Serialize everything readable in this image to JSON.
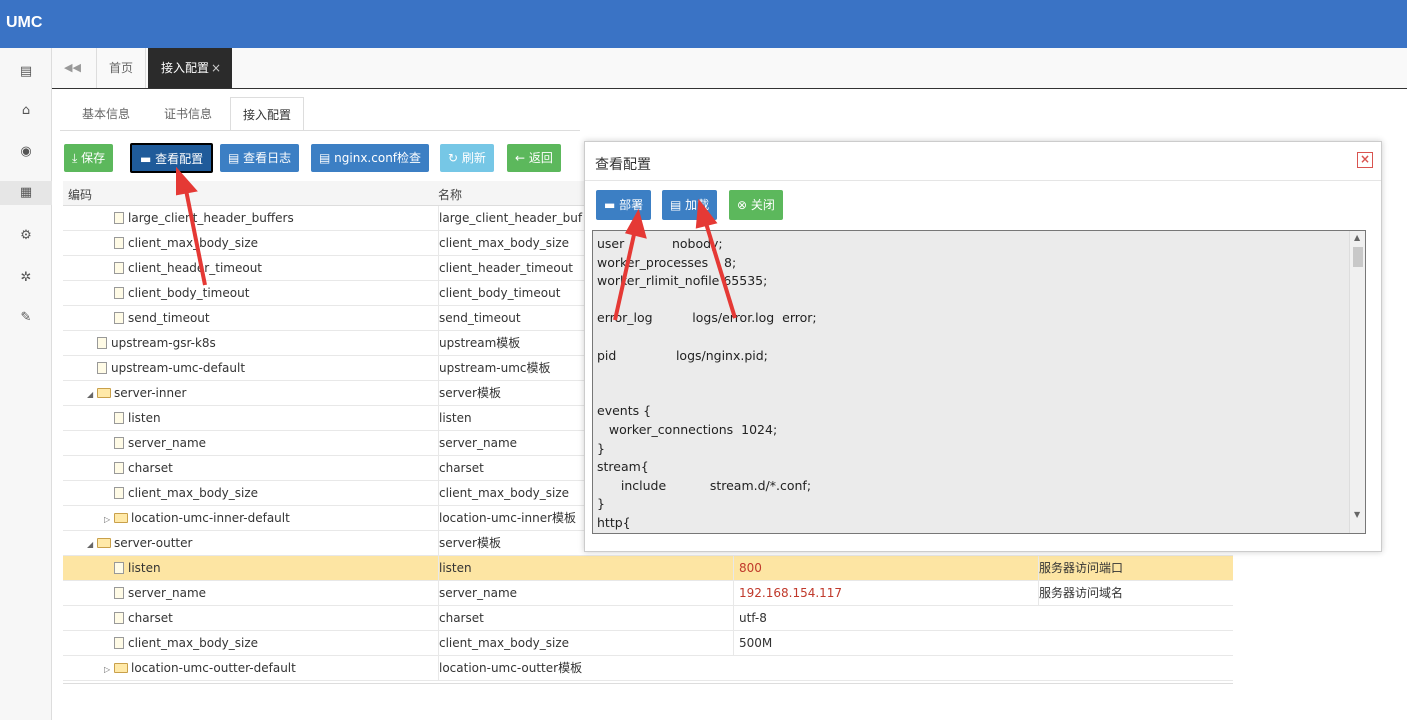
{
  "app": {
    "logo": "UMC"
  },
  "tabs": {
    "home": "首页",
    "active": "接入配置",
    "close": "×"
  },
  "subtabs": [
    "基本信息",
    "证书信息",
    "接入配置"
  ],
  "toolbar": {
    "save": "保存",
    "view_config": "查看配置",
    "view_log": "查看日志",
    "nginx_check": "nginx.conf检查",
    "refresh": "刷新",
    "back": "返回"
  },
  "grid": {
    "headers": [
      "编码",
      "名称"
    ],
    "rows": [
      {
        "code": "large_client_header_buffers",
        "name": "large_client_header_buf",
        "value": "",
        "desc": "",
        "type": "file",
        "level": 2
      },
      {
        "code": "client_max_body_size",
        "name": "client_max_body_size",
        "value": "",
        "desc": "",
        "type": "file",
        "level": 2
      },
      {
        "code": "client_header_timeout",
        "name": "client_header_timeout",
        "value": "",
        "desc": "",
        "type": "file",
        "level": 2
      },
      {
        "code": "client_body_timeout",
        "name": "client_body_timeout",
        "value": "",
        "desc": "",
        "type": "file",
        "level": 2
      },
      {
        "code": "send_timeout",
        "name": "send_timeout",
        "value": "",
        "desc": "",
        "type": "file",
        "level": 2
      },
      {
        "code": "upstream-gsr-k8s",
        "name": "upstream模板",
        "value": "",
        "desc": "",
        "type": "file",
        "level": 1
      },
      {
        "code": "upstream-umc-default",
        "name": "upstream-umc模板",
        "value": "",
        "desc": "",
        "type": "file",
        "level": 1
      },
      {
        "code": "server-inner",
        "name": "server模板",
        "value": "",
        "desc": "",
        "type": "folder-open",
        "level": 1
      },
      {
        "code": "listen",
        "name": "listen",
        "value": "",
        "desc": "",
        "type": "file",
        "level": 2
      },
      {
        "code": "server_name",
        "name": "server_name",
        "value": "",
        "desc": "",
        "type": "file",
        "level": 2
      },
      {
        "code": "charset",
        "name": "charset",
        "value": "",
        "desc": "",
        "type": "file",
        "level": 2
      },
      {
        "code": "client_max_body_size",
        "name": "client_max_body_size",
        "value": "",
        "desc": "",
        "type": "file",
        "level": 2
      },
      {
        "code": "location-umc-inner-default",
        "name": "location-umc-inner模板",
        "value": "",
        "desc": "",
        "type": "folder-closed",
        "level": 2
      },
      {
        "code": "server-outter",
        "name": "server模板",
        "value": "",
        "desc": "",
        "type": "folder-open",
        "level": 1
      },
      {
        "code": "listen",
        "name": "listen",
        "value": "800",
        "desc": "服务器访问端口",
        "type": "file",
        "level": 2,
        "selected": true
      },
      {
        "code": "server_name",
        "name": "server_name",
        "value": "192.168.154.117",
        "desc": "服务器访问域名",
        "type": "file",
        "level": 2
      },
      {
        "code": "charset",
        "name": "charset",
        "value": "utf-8",
        "desc": "",
        "type": "file",
        "level": 2
      },
      {
        "code": "client_max_body_size",
        "name": "client_max_body_size",
        "value": "500M",
        "desc": "",
        "type": "file",
        "level": 2
      },
      {
        "code": "location-umc-outter-default",
        "name": "location-umc-outter模板",
        "value": "",
        "desc": "",
        "type": "folder-closed",
        "level": 2
      }
    ]
  },
  "dialog": {
    "title": "查看配置",
    "close": "×",
    "deploy": "部署",
    "load": "加载",
    "close_button": "关闭",
    "content": "user            nobody;\nworker_processes    8;\nworker_rlimit_nofile 65535;\n\nerror_log          logs/error.log  error;\n\npid               logs/nginx.pid;\n\n\nevents {\n   worker_connections  1024;\n}\nstream{\n      include           stream.d/*.conf;\n}\nhttp{"
  }
}
